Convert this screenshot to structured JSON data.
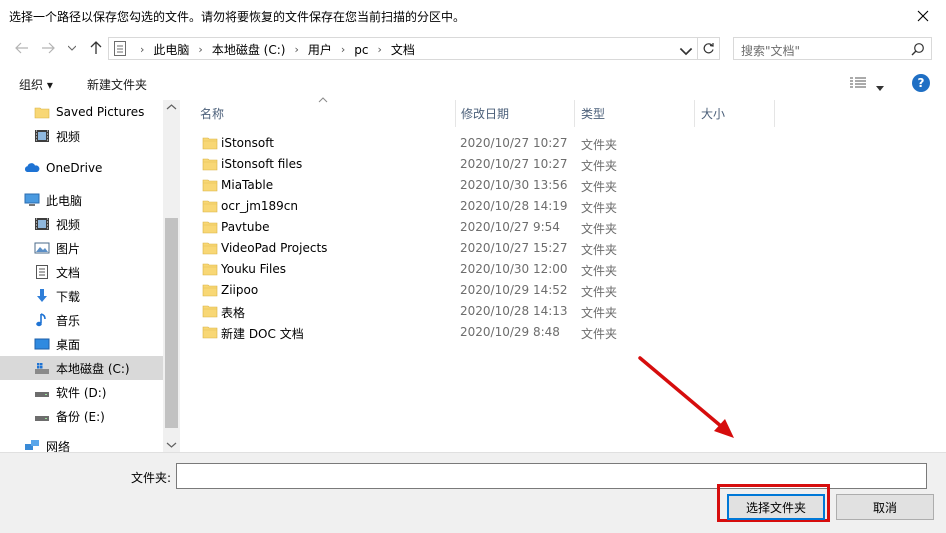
{
  "window": {
    "title": "选择一个路径以保存您勾选的文件。请勿将要恢复的文件保存在您当前扫描的分区中。"
  },
  "address": {
    "crumbs": [
      "此电脑",
      "本地磁盘 (C:)",
      "用户",
      "pc",
      "文档"
    ]
  },
  "search": {
    "placeholder": "搜索\"文档\""
  },
  "toolbar": {
    "organize": "组织 ▾",
    "new_folder": "新建文件夹"
  },
  "sidebar": {
    "items": [
      {
        "label": "Saved Pictures",
        "icon": "folder-icon"
      },
      {
        "label": "视频",
        "icon": "video-icon"
      },
      {
        "label": "OneDrive",
        "icon": "cloud-icon"
      },
      {
        "label": "此电脑",
        "icon": "computer-icon"
      },
      {
        "label": "视频",
        "icon": "video-icon"
      },
      {
        "label": "图片",
        "icon": "picture-icon"
      },
      {
        "label": "文档",
        "icon": "document-icon"
      },
      {
        "label": "下载",
        "icon": "download-icon"
      },
      {
        "label": "音乐",
        "icon": "music-icon"
      },
      {
        "label": "桌面",
        "icon": "desktop-icon"
      },
      {
        "label": "本地磁盘 (C:)",
        "icon": "drive-icon",
        "selected": true
      },
      {
        "label": "软件 (D:)",
        "icon": "drive-icon"
      },
      {
        "label": "备份 (E:)",
        "icon": "drive-icon"
      },
      {
        "label": "网络",
        "icon": "network-icon"
      }
    ]
  },
  "list": {
    "columns": {
      "name": "名称",
      "date": "修改日期",
      "type": "类型",
      "size": "大小"
    },
    "rows": [
      {
        "name": "iStonsoft",
        "date": "2020/10/27 10:27",
        "type": "文件夹"
      },
      {
        "name": "iStonsoft files",
        "date": "2020/10/27 10:27",
        "type": "文件夹"
      },
      {
        "name": "MiaTable",
        "date": "2020/10/30 13:56",
        "type": "文件夹"
      },
      {
        "name": "ocr_jm189cn",
        "date": "2020/10/28 14:19",
        "type": "文件夹"
      },
      {
        "name": "Pavtube",
        "date": "2020/10/27 9:54",
        "type": "文件夹"
      },
      {
        "name": "VideoPad Projects",
        "date": "2020/10/27 15:27",
        "type": "文件夹"
      },
      {
        "name": "Youku Files",
        "date": "2020/10/30 12:00",
        "type": "文件夹"
      },
      {
        "name": "Ziipoo",
        "date": "2020/10/29 14:52",
        "type": "文件夹"
      },
      {
        "name": "表格",
        "date": "2020/10/28 14:13",
        "type": "文件夹"
      },
      {
        "name": "新建 DOC 文档",
        "date": "2020/10/29 8:48",
        "type": "文件夹"
      }
    ]
  },
  "footer": {
    "folder_label": "文件夹:",
    "folder_value": "",
    "select_button": "选择文件夹",
    "cancel_button": "取消"
  },
  "colors": {
    "accent": "#0078d7",
    "annotation": "#d60d0d",
    "folder": "#f8d775"
  }
}
